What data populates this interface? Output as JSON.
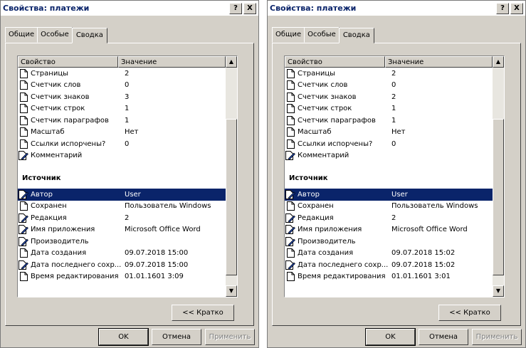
{
  "dialogs": [
    {
      "title": "Свойства: платежи",
      "help_button": "?",
      "close_button": "X",
      "tabs": [
        "Общие",
        "Особые",
        "Сводка"
      ],
      "active_tab": "Сводка",
      "columns": {
        "property": "Свойство",
        "value": "Значение"
      },
      "rows_top": [
        {
          "name": "Страницы",
          "value": "2",
          "icon": "doc-icon"
        },
        {
          "name": "Счетчик слов",
          "value": "0",
          "icon": "doc-icon"
        },
        {
          "name": "Счетчик знаков",
          "value": "3",
          "icon": "doc-icon"
        },
        {
          "name": "Счетчик строк",
          "value": "1",
          "icon": "doc-icon"
        },
        {
          "name": "Счетчик параграфов",
          "value": "1",
          "icon": "doc-icon"
        },
        {
          "name": "Масштаб",
          "value": "Нет",
          "icon": "doc-icon"
        },
        {
          "name": "Ссылки испорчены?",
          "value": "0",
          "icon": "doc-icon"
        },
        {
          "name": "Комментарий",
          "value": "",
          "icon": "edit-doc-icon"
        }
      ],
      "section_label": "Источник",
      "rows_bottom": [
        {
          "name": "Автор",
          "value": "User",
          "icon": "edit-doc-icon",
          "selected": true
        },
        {
          "name": "Сохранен",
          "value": "Пользователь Windows",
          "icon": "doc-icon"
        },
        {
          "name": "Редакция",
          "value": "2",
          "icon": "edit-doc-icon"
        },
        {
          "name": "Имя приложения",
          "value": "Microsoft Office Word",
          "icon": "edit-doc-icon"
        },
        {
          "name": "Производитель",
          "value": "",
          "icon": "edit-doc-icon"
        },
        {
          "name": "Дата создания",
          "value": "09.07.2018 15:00",
          "icon": "doc-icon"
        },
        {
          "name": "Дата последнего сохр...",
          "value": "09.07.2018 15:00",
          "icon": "edit-doc-icon"
        },
        {
          "name": "Время редактирования",
          "value": "01.01.1601 3:09",
          "icon": "doc-icon"
        }
      ],
      "less_button": "<< Кратко",
      "ok_button": "OK",
      "cancel_button": "Отмена",
      "apply_button": "Применить"
    },
    {
      "title": "Свойства: платежи",
      "help_button": "?",
      "close_button": "X",
      "tabs": [
        "Общие",
        "Особые",
        "Сводка"
      ],
      "active_tab": "Сводка",
      "columns": {
        "property": "Свойство",
        "value": "Значение"
      },
      "rows_top": [
        {
          "name": "Страницы",
          "value": "2",
          "icon": "doc-icon"
        },
        {
          "name": "Счетчик слов",
          "value": "0",
          "icon": "doc-icon"
        },
        {
          "name": "Счетчик знаков",
          "value": "2",
          "icon": "doc-icon"
        },
        {
          "name": "Счетчик строк",
          "value": "1",
          "icon": "doc-icon"
        },
        {
          "name": "Счетчик параграфов",
          "value": "1",
          "icon": "doc-icon"
        },
        {
          "name": "Масштаб",
          "value": "Нет",
          "icon": "doc-icon"
        },
        {
          "name": "Ссылки испорчены?",
          "value": "0",
          "icon": "doc-icon"
        },
        {
          "name": "Комментарий",
          "value": "",
          "icon": "edit-doc-icon"
        }
      ],
      "section_label": "Источник",
      "rows_bottom": [
        {
          "name": "Автор",
          "value": "User",
          "icon": "edit-doc-icon",
          "selected": true
        },
        {
          "name": "Сохранен",
          "value": "Пользователь Windows",
          "icon": "doc-icon"
        },
        {
          "name": "Редакция",
          "value": "2",
          "icon": "edit-doc-icon"
        },
        {
          "name": "Имя приложения",
          "value": "Microsoft Office Word",
          "icon": "edit-doc-icon"
        },
        {
          "name": "Производитель",
          "value": "",
          "icon": "edit-doc-icon"
        },
        {
          "name": "Дата создания",
          "value": "09.07.2018 15:02",
          "icon": "doc-icon"
        },
        {
          "name": "Дата последнего сохр...",
          "value": "09.07.2018 15:02",
          "icon": "edit-doc-icon"
        },
        {
          "name": "Время редактирования",
          "value": "01.01.1601 3:01",
          "icon": "doc-icon"
        }
      ],
      "less_button": "<< Кратко",
      "ok_button": "OK",
      "cancel_button": "Отмена",
      "apply_button": "Применить"
    }
  ],
  "colors": {
    "title_text": "#0a246a",
    "selection": "#0a246a",
    "face": "#d4d0c8"
  }
}
